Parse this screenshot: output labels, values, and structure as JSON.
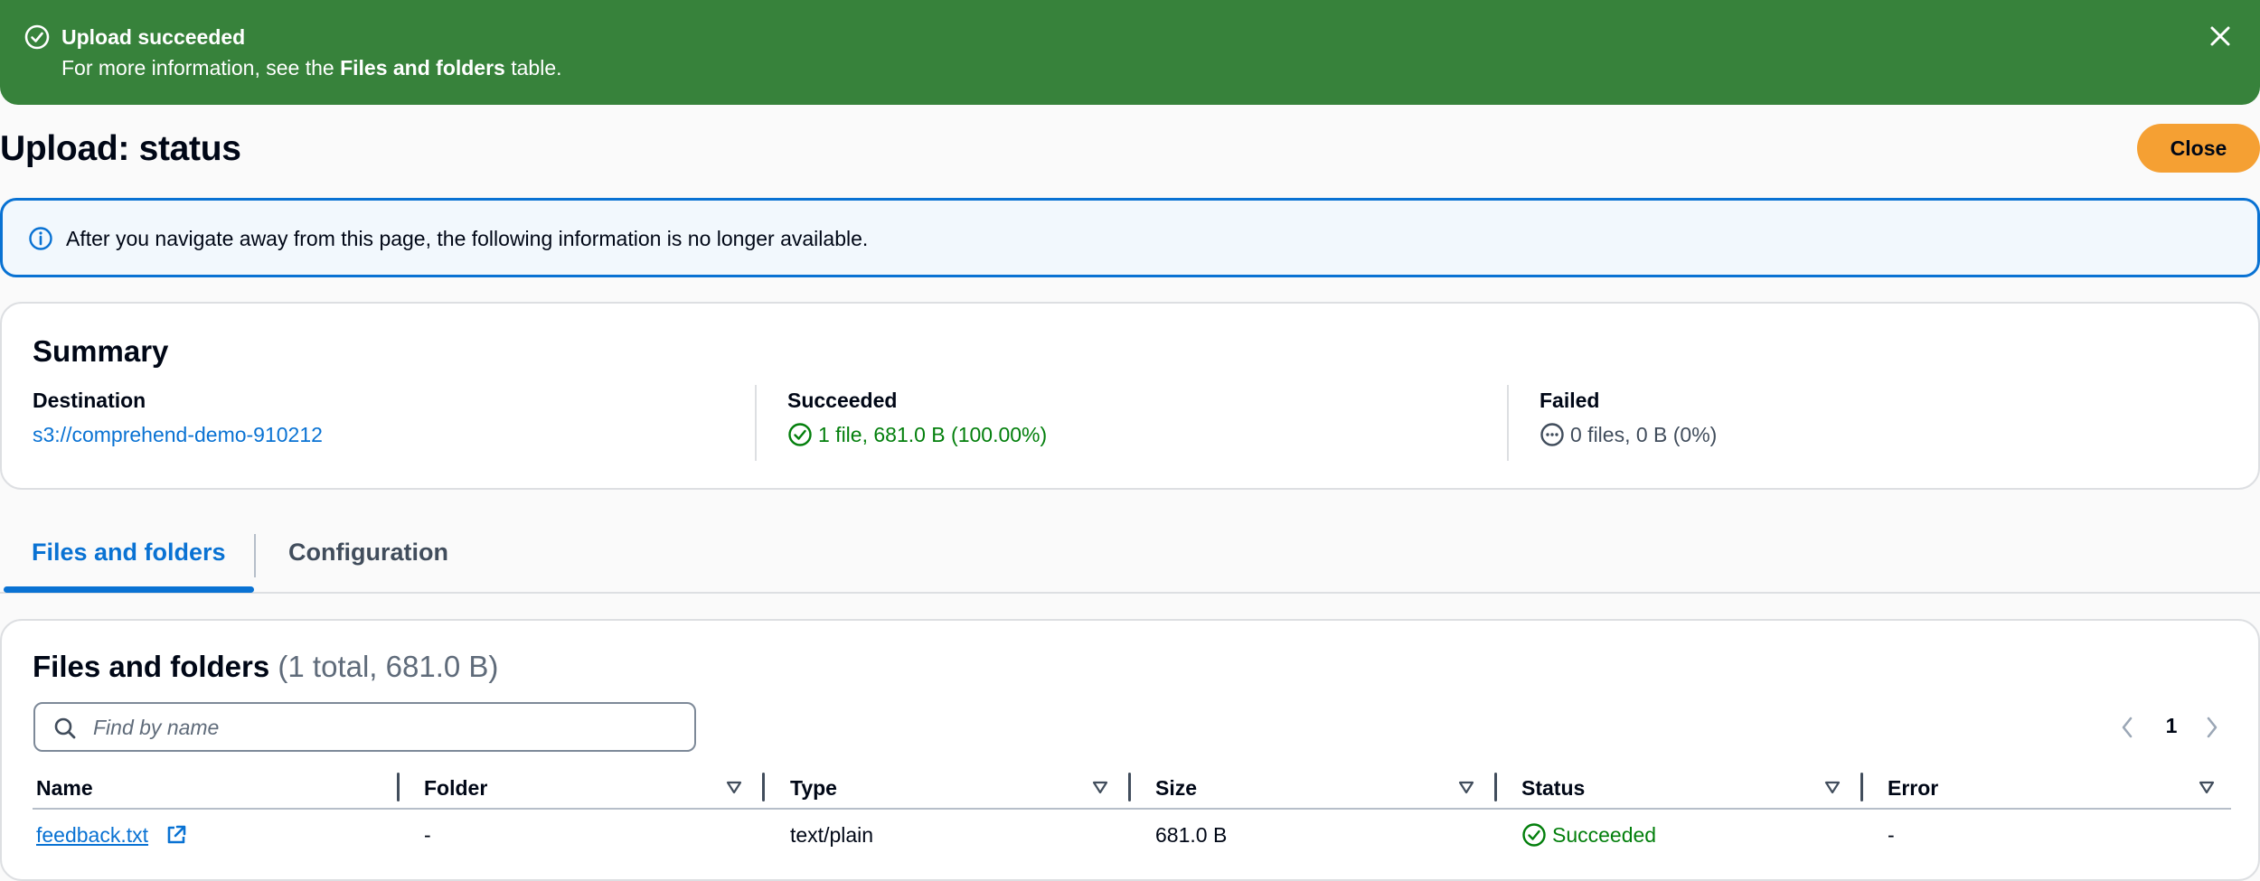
{
  "flash": {
    "title": "Upload succeeded",
    "message_prefix": "For more information, see the ",
    "message_bold": "Files and folders",
    "message_suffix": " table.",
    "color": "#37823b"
  },
  "header": {
    "title": "Upload: status",
    "close_label": "Close",
    "close_color": "#f5a033"
  },
  "info": {
    "text": "After you navigate away from this page, the following information is no longer available."
  },
  "summary": {
    "heading": "Summary",
    "destination": {
      "label": "Destination",
      "value": "s3://comprehend-demo-910212"
    },
    "succeeded": {
      "label": "Succeeded",
      "value": "1 file, 681.0 B (100.00%)",
      "icon": "check-circle-icon"
    },
    "failed": {
      "label": "Failed",
      "value": "0 files, 0 B (0%)",
      "icon": "dots-circle-icon"
    }
  },
  "tabs": [
    {
      "label": "Files and folders",
      "active": true
    },
    {
      "label": "Configuration",
      "active": false
    }
  ],
  "files": {
    "heading": "Files and folders",
    "count": "(1 total, 681.0 B)",
    "search_placeholder": "Find by name",
    "page": "1",
    "columns": [
      "Name",
      "Folder",
      "Type",
      "Size",
      "Status",
      "Error"
    ],
    "rows": [
      {
        "name": "feedback.txt",
        "folder": "-",
        "type": "text/plain",
        "size": "681.0 B",
        "status": "Succeeded",
        "error": "-"
      }
    ]
  },
  "colors": {
    "link": "#0972d3",
    "success": "#037f0c"
  }
}
